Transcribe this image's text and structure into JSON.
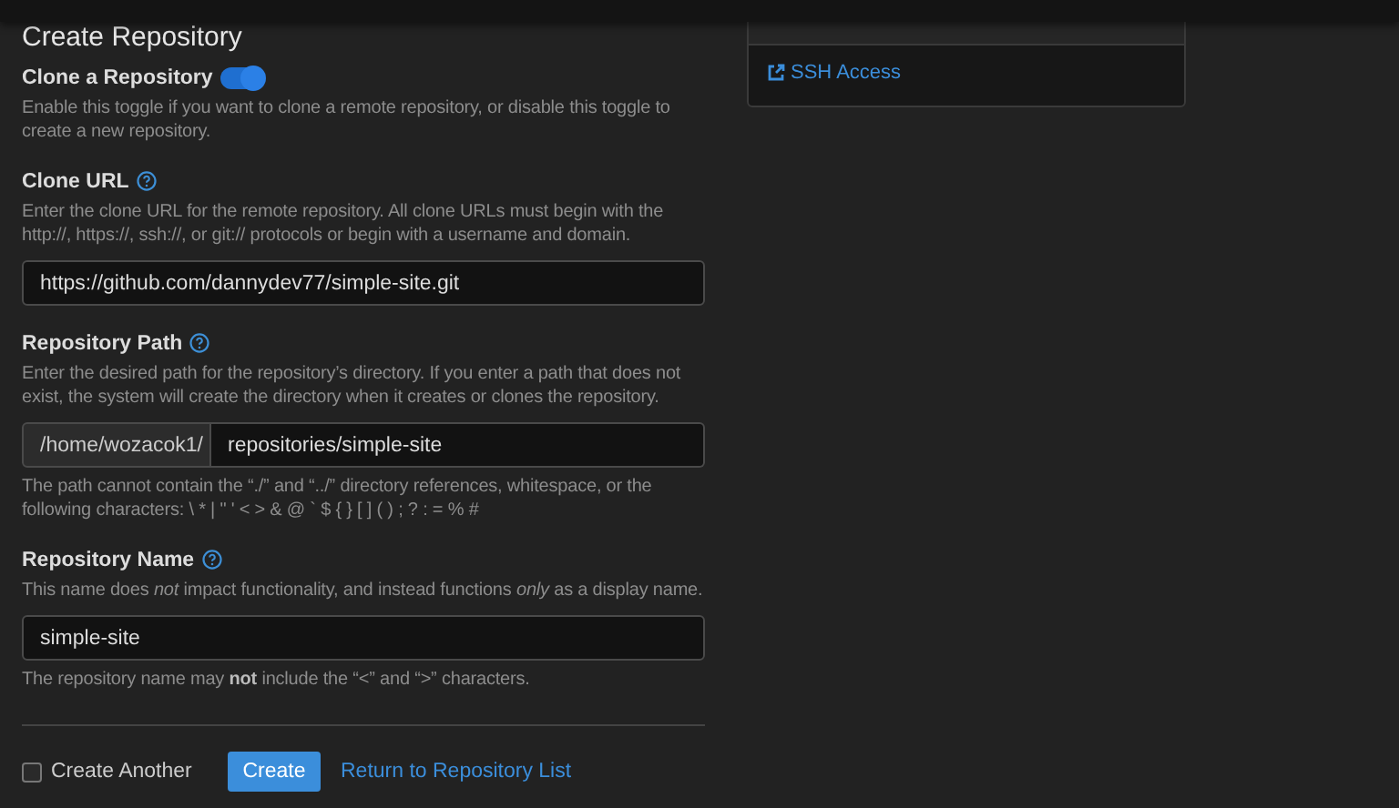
{
  "page_title": "Create Repository",
  "clone_toggle": {
    "label": "Clone a Repository",
    "on": true,
    "help": "Enable this toggle if you want to clone a remote repository, or disable this toggle to create a new repository."
  },
  "fields": [
    {
      "kind": "text",
      "label": "Clone URL",
      "help": "Enter the clone URL for the remote repository. All clone URLs must begin with the http://, https://, ssh://, or git:// protocols or begin with a username and domain.",
      "value": "https://github.com/dannydev77/simple-site.git"
    },
    {
      "kind": "path",
      "label": "Repository Path",
      "help": "Enter the desired path for the repository’s directory. If you enter a path that does not exist, the system will create the directory when it creates or clones the repository.",
      "prefix": "/home/wozacok1/",
      "value": "repositories/simple-site",
      "note": "The path cannot contain the “./” and “../” directory references, whitespace, or the following characters: \\ * | \" ' < > & @ ` $ { } [ ] ( ) ; ? : = % #"
    },
    {
      "kind": "text",
      "label": "Repository Name",
      "help": "This name does *not* impact functionality, and instead functions *only* as a display name.",
      "value": "simple-site",
      "note": "The repository name may **not** include the “<” and “>” characters."
    }
  ],
  "create_another": {
    "label": "Create Another",
    "checked": false
  },
  "create_button": "Create",
  "return_link": "Return to Repository List",
  "related_links": [
    {
      "label": "SSH Access"
    }
  ]
}
